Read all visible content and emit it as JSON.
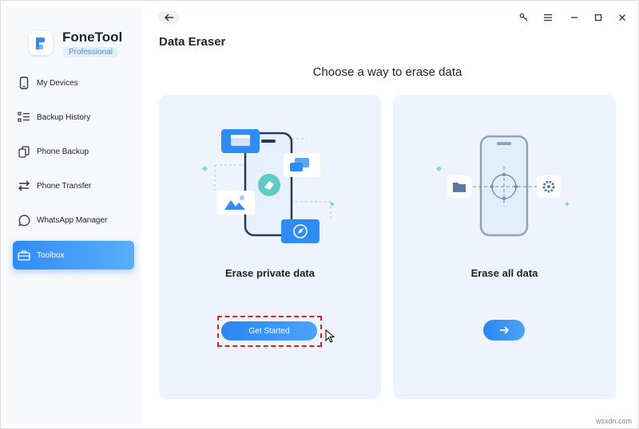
{
  "app": {
    "name": "FoneTool",
    "edition": "Professional"
  },
  "sidebar": {
    "items": [
      {
        "label": "My Devices",
        "icon": "phone-icon"
      },
      {
        "label": "Backup History",
        "icon": "list-icon"
      },
      {
        "label": "Phone Backup",
        "icon": "copy-icon"
      },
      {
        "label": "Phone Transfer",
        "icon": "transfer-icon"
      },
      {
        "label": "WhatsApp Manager",
        "icon": "whatsapp-icon"
      },
      {
        "label": "Toolbox",
        "icon": "toolbox-icon",
        "active": true
      }
    ]
  },
  "header": {
    "page_title": "Data Eraser",
    "subtitle": "Choose a way to erase data"
  },
  "options": [
    {
      "title": "Erase private data",
      "button_label": "Get Started"
    },
    {
      "title": "Erase all data",
      "button_icon": "arrow-right-icon"
    }
  ],
  "watermark": "wsxdn.com",
  "colors": {
    "accent": "#2f8cf5",
    "card_bg": "#eff4fc",
    "sidebar_bg": "#f6f8fb",
    "highlight": "#e02020"
  }
}
